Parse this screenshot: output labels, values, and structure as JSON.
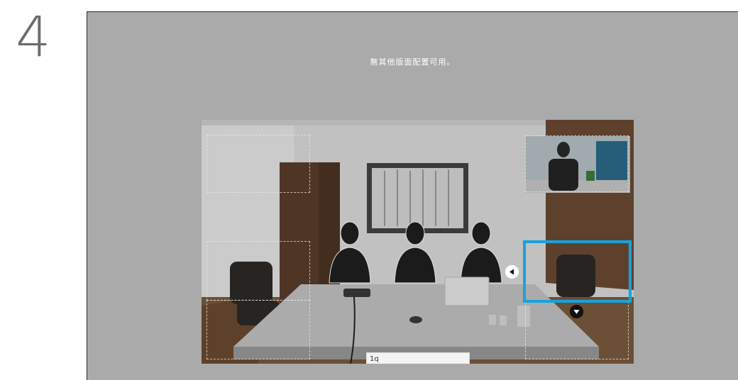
{
  "step": {
    "number": "4"
  },
  "screen": {
    "message": "無其他版面配置可用。"
  },
  "preview": {
    "input_value": "1q",
    "buttons": [
      {
        "icon": "triangle-left-icon"
      },
      {
        "icon": "triangle-down-icon"
      }
    ]
  },
  "colors": {
    "frame_background": "#aaaaaa",
    "selection_border": "#17a3dc",
    "step_number": "#6b6b6b"
  }
}
